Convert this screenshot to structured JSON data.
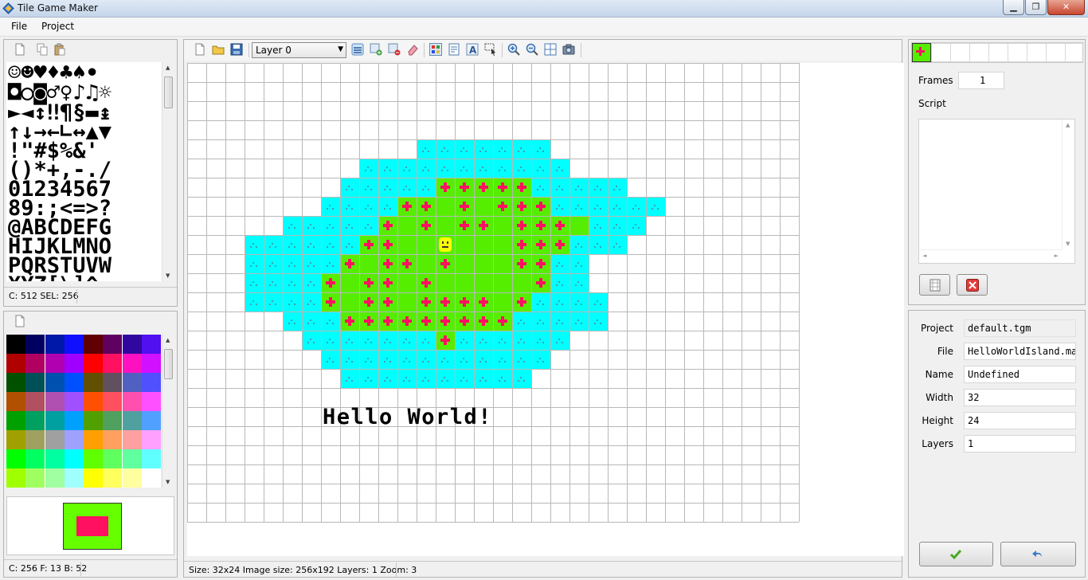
{
  "window": {
    "title": "Tile Game Maker",
    "controls": {
      "minimize": "▁",
      "maximize": "❐",
      "close": "✕"
    }
  },
  "menu": [
    "File",
    "Project"
  ],
  "tileset_panel": {
    "status": "C: 512 SEL: 256"
  },
  "palette_panel": {
    "status": "C: 256 F: 13 B: 52",
    "colors": [
      "#000000",
      "#000060",
      "#0018a8",
      "#1010ff",
      "#600000",
      "#600060",
      "#3008a0",
      "#5010f0",
      "#b00000",
      "#b00060",
      "#b000b0",
      "#a000ff",
      "#ff0000",
      "#ff1060",
      "#ff10c0",
      "#d010ff",
      "#005000",
      "#005058",
      "#0050b0",
      "#0050ff",
      "#605000",
      "#605060",
      "#5060c0",
      "#5050ff",
      "#b05000",
      "#b05060",
      "#b050b0",
      "#a050ff",
      "#ff5000",
      "#ff5060",
      "#ff50b0",
      "#ff50ff",
      "#00a000",
      "#00a060",
      "#00a0a0",
      "#00a0ff",
      "#50a000",
      "#50a060",
      "#50a0a0",
      "#50a0ff",
      "#a0a000",
      "#a0a060",
      "#a0a0a0",
      "#a0a0ff",
      "#ffa000",
      "#ffa060",
      "#ffa0a0",
      "#ffa0ff",
      "#00ff00",
      "#00ff60",
      "#00ffa0",
      "#00ffff",
      "#60ff00",
      "#60ff60",
      "#60ffa0",
      "#60ffff",
      "#a0ff00",
      "#a0ff60",
      "#a0ffa0",
      "#a0ffff",
      "#ffff00",
      "#ffff60",
      "#ffffa0",
      "#ffffff"
    ],
    "fg_color": "#66ff00",
    "bg_color": "#ff1060"
  },
  "editor": {
    "layer_select": "Layer 0",
    "status": "Size: 32x24 Image size: 256x192 Layers: 1 Zoom: 3",
    "map_text": "Hello World!",
    "colors": {
      "water": "#00ffff",
      "grass": "#55ee00",
      "flower": "#ff1060",
      "smiley": "#ffff00"
    }
  },
  "frames_panel": {
    "frames_label": "Frames",
    "frames_value": "1",
    "script_label": "Script",
    "script_value": ""
  },
  "properties": {
    "project_label": "Project",
    "project_value": "default.tgm",
    "file_label": "File",
    "file_value": "HelloWorldIsland.map",
    "name_label": "Name",
    "name_value": "Undefined",
    "width_label": "Width",
    "width_value": "32",
    "height_label": "Height",
    "height_value": "24",
    "layers_label": "Layers",
    "layers_value": "1"
  },
  "icons": [
    "new-file-icon",
    "copy-icon",
    "paste-icon",
    "open-folder-icon",
    "save-icon",
    "checkmark-icon",
    "undo-icon",
    "delete-icon"
  ]
}
